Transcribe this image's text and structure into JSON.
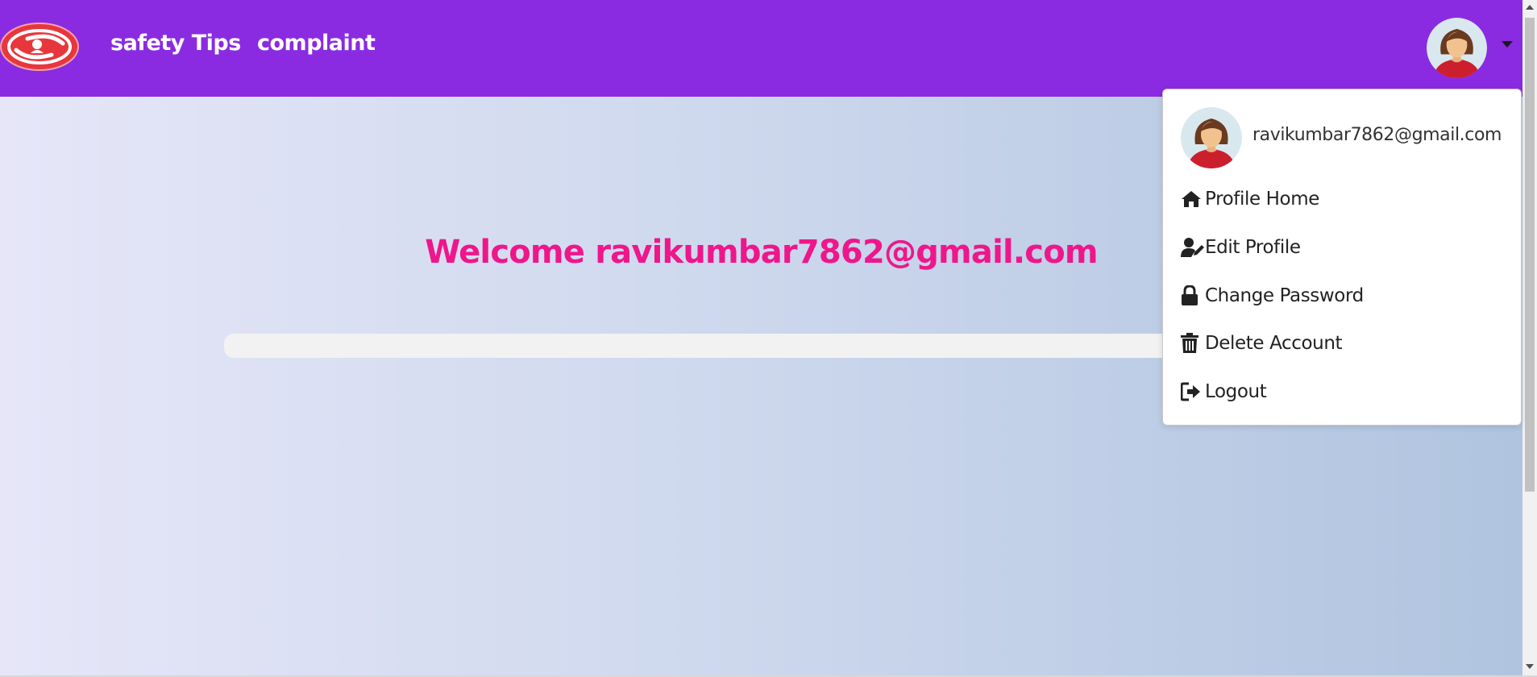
{
  "navbar": {
    "logo_icon": "women-safety-hands-logo-icon",
    "links": [
      {
        "label": "safety Tips"
      },
      {
        "label": "complaint"
      }
    ],
    "avatar_icon": "female-avatar-icon",
    "caret_icon": "caret-down-icon",
    "bg_color": "#8a2be2"
  },
  "main": {
    "welcome_text": "Welcome ravikumbar7862@gmail.com",
    "welcome_color": "#ef168b"
  },
  "dropdown": {
    "email": "ravikumbar7862@gmail.com",
    "items": [
      {
        "label": "Profile Home",
        "icon": "home-icon"
      },
      {
        "label": "Edit Profile",
        "icon": "user-edit-icon"
      },
      {
        "label": "Change Password",
        "icon": "lock-icon"
      },
      {
        "label": "Delete Account",
        "icon": "trash-icon"
      },
      {
        "label": "Logout",
        "icon": "logout-icon"
      }
    ]
  }
}
